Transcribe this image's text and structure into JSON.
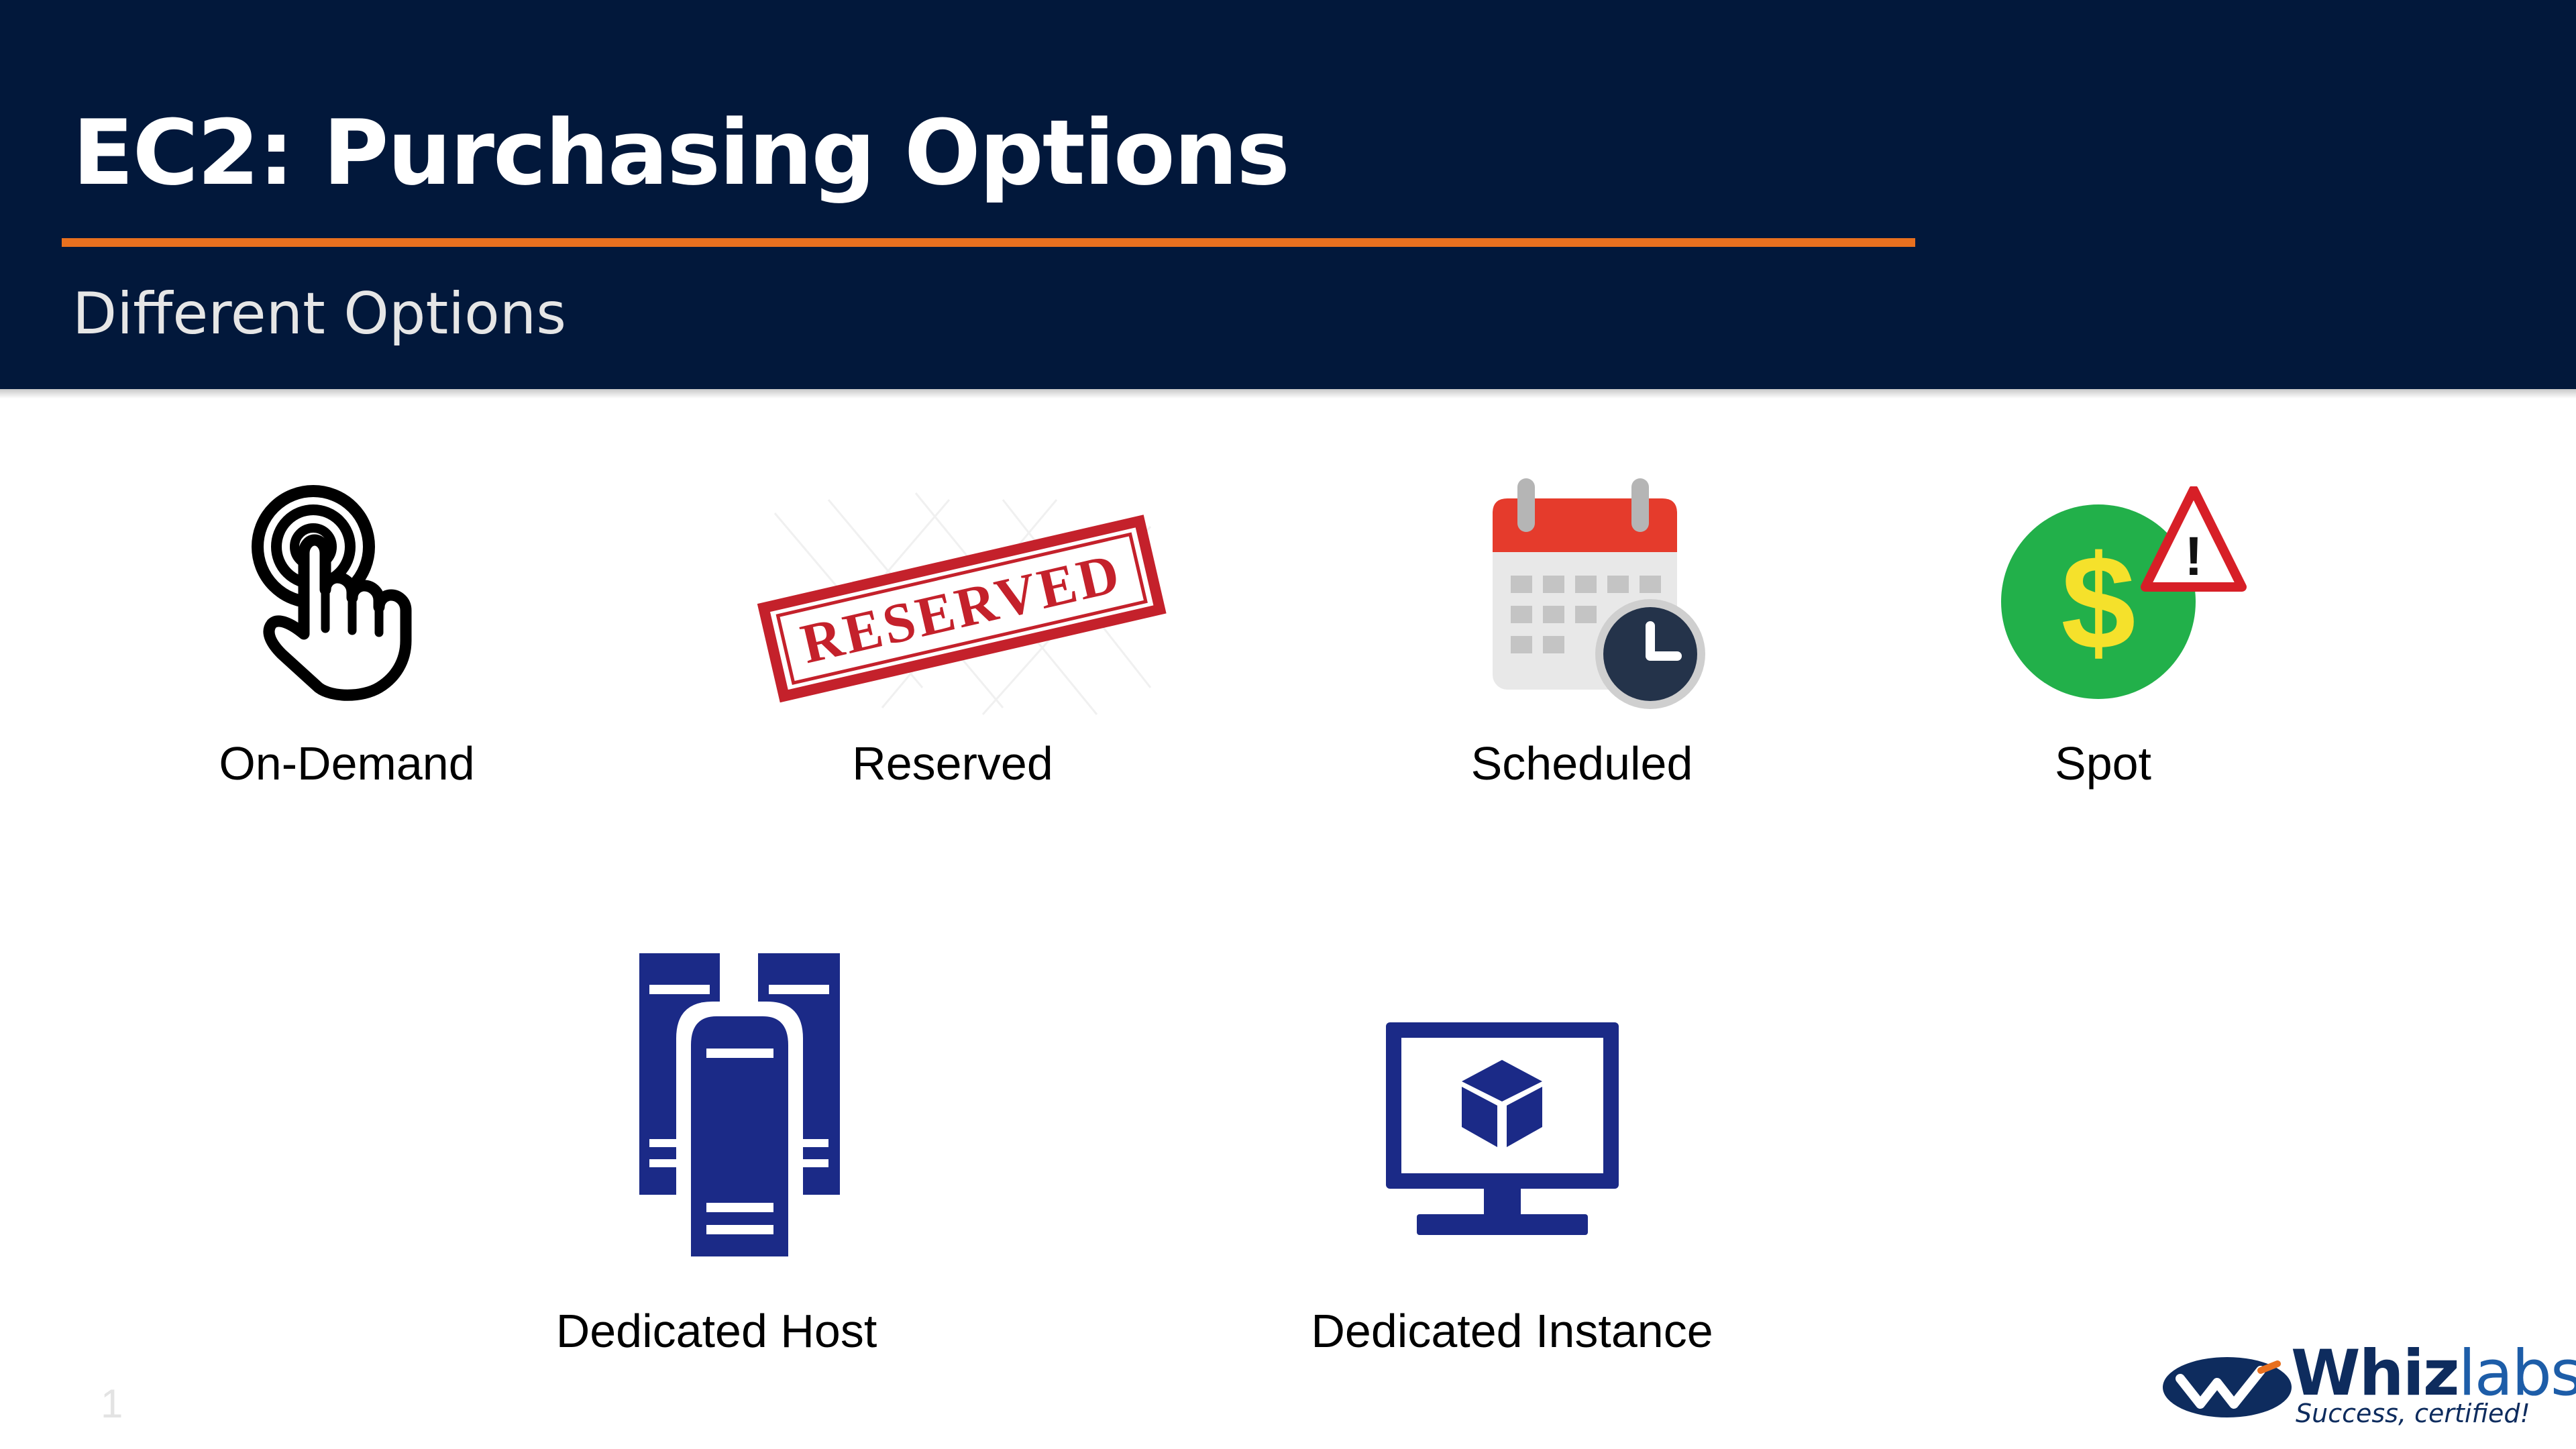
{
  "header": {
    "title": "EC2: Purchasing Options",
    "subtitle": "Different Options"
  },
  "options": [
    {
      "label": "On-Demand",
      "icon": "tap-hand-icon"
    },
    {
      "label": "Reserved",
      "icon": "reserved-stamp-icon",
      "stamp_text": "RESERVED"
    },
    {
      "label": "Scheduled",
      "icon": "calendar-clock-icon"
    },
    {
      "label": "Spot",
      "icon": "dollar-warning-icon"
    },
    {
      "label": "Dedicated Host",
      "icon": "server-icon"
    },
    {
      "label": "Dedicated Instance",
      "icon": "monitor-cube-icon"
    }
  ],
  "page_number": "1",
  "logo": {
    "name_bold": "Whiz",
    "name_light": "labs",
    "tagline": "Success, certified!"
  },
  "colors": {
    "header_bg": "#02183b",
    "accent": "#e8701f",
    "icon_blue": "#1b2a87",
    "stamp_red": "#c4212b",
    "spot_green": "#22b04a",
    "calendar_red": "#e53b2c"
  }
}
